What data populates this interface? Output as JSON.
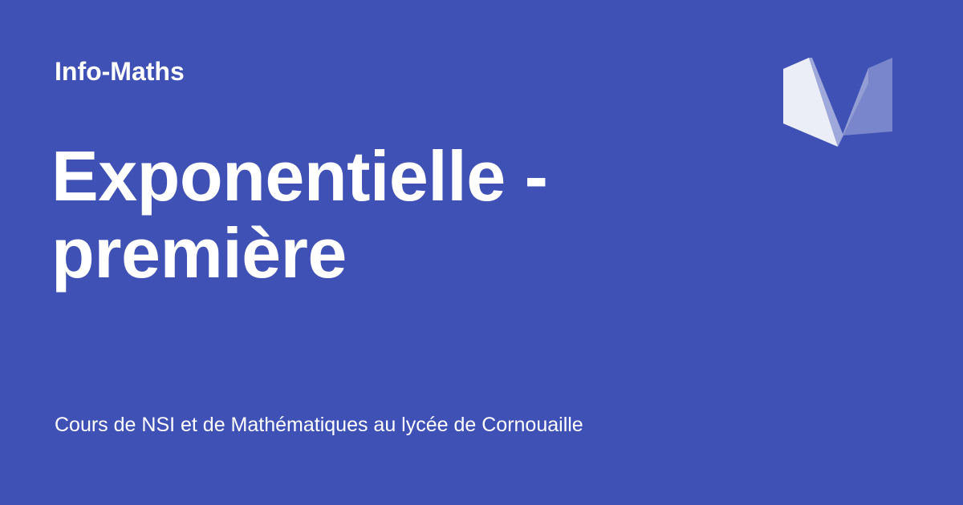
{
  "header": {
    "site_name": "Info-Maths"
  },
  "main": {
    "title_line1": "Exponentielle -",
    "title_line2": "première"
  },
  "footer": {
    "description": "Cours de NSI et de Mathématiques au lycée de Cornouaille"
  },
  "logo": {
    "icon": "material-m-logo-icon"
  },
  "colors": {
    "background": "#3f51b5",
    "text": "#ffffff"
  }
}
